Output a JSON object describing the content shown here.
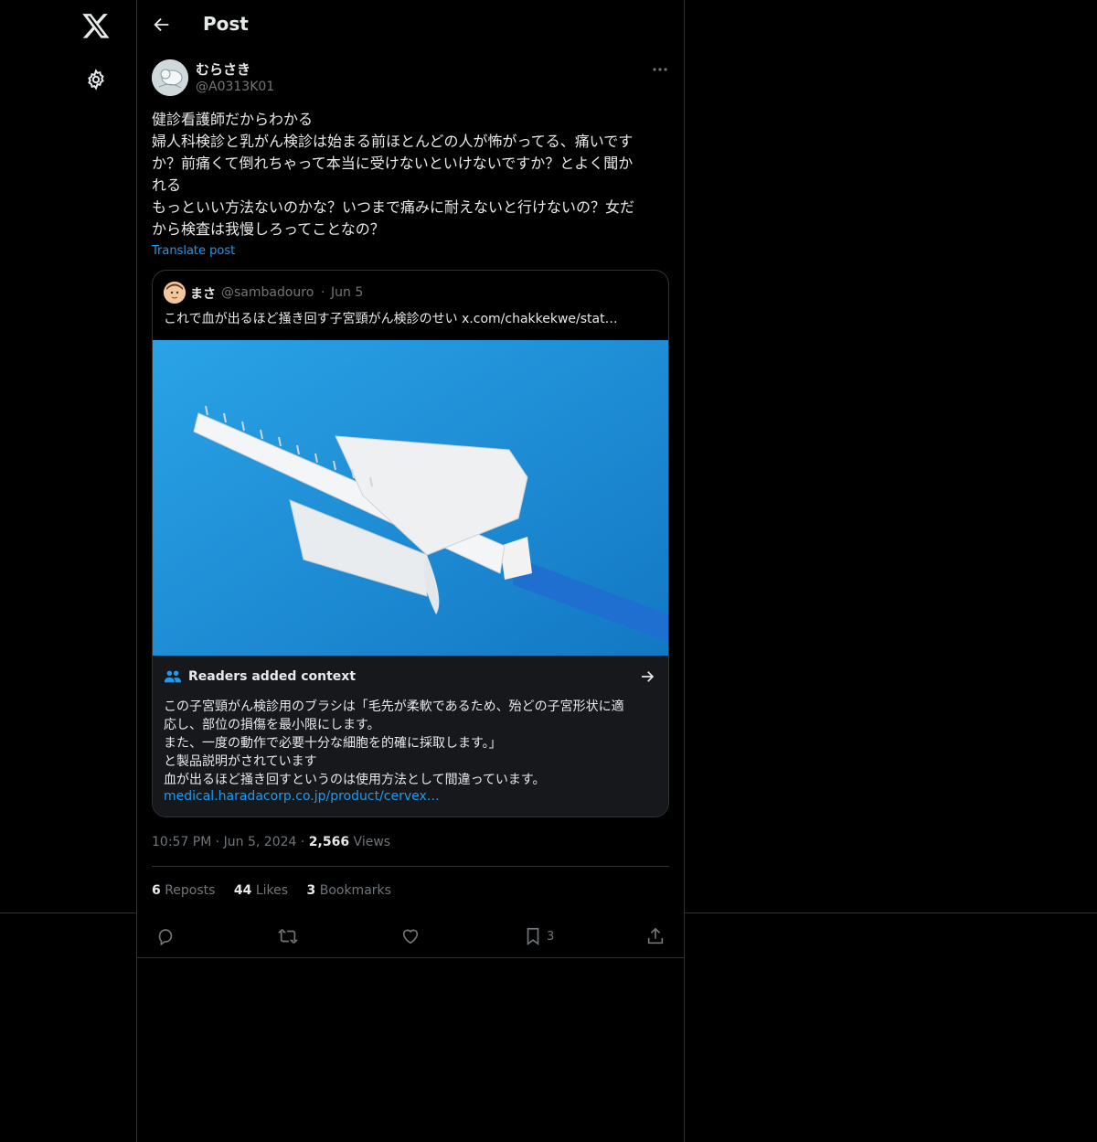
{
  "colors": {
    "accent": "#1d9bf0",
    "text": "#e7e9ea",
    "muted": "#71767b",
    "border": "#2f3336",
    "image_bg": "#1f93d8"
  },
  "nav": {
    "logo_icon": "x-logo-icon",
    "settings_icon": "gear-icon"
  },
  "header": {
    "title": "Post",
    "back_icon": "arrow-left-icon"
  },
  "post": {
    "author_name": "むらさき",
    "author_handle": "@A0313K01",
    "body": "健診看護師だからわかる\n婦人科検診と乳がん検診は始まる前ほとんどの人が怖がってる、痛いです\nか？前痛くて倒れちゃって本当に受けないといけないですか？とよく聞か\nれる\nもっといい方法ないのかな？いつまで痛みに耐えないと行けないの？女だ\nから検査は我慢しろってことなの？",
    "translate_label": "Translate post",
    "timestamp": "10:57 PM · Jun 5, 2024",
    "views_count": "2,566",
    "views_label": "Views",
    "reposts_count": "6",
    "reposts_label": "Reposts",
    "likes_count": "44",
    "likes_label": "Likes",
    "bookmarks_count": "3",
    "bookmarks_label": "Bookmarks"
  },
  "quote": {
    "author_name": "まさ",
    "author_handle": "@sambadouro",
    "separator": "·",
    "date": "Jun 5",
    "text": "これで血が出るほど掻き回す子宮頸がん検診のせい ",
    "link": "x.com/chakkekwe/stat…"
  },
  "notes": {
    "title": "Readers added context",
    "body": "この子宮頸がん検診用のブラシは「毛先が柔軟であるため、殆どの子宮形状に適\n応し、部位の損傷を最小限にします。\nまた、一度の動作で必要十分な細胞を的確に採取します。」\nと製品説明がされています\n血が出るほど掻き回すというのは使用方法として間違っています。",
    "link": "medical.haradacorp.co.jp/product/cervex…"
  },
  "actions": {
    "bookmark_count": "3"
  }
}
